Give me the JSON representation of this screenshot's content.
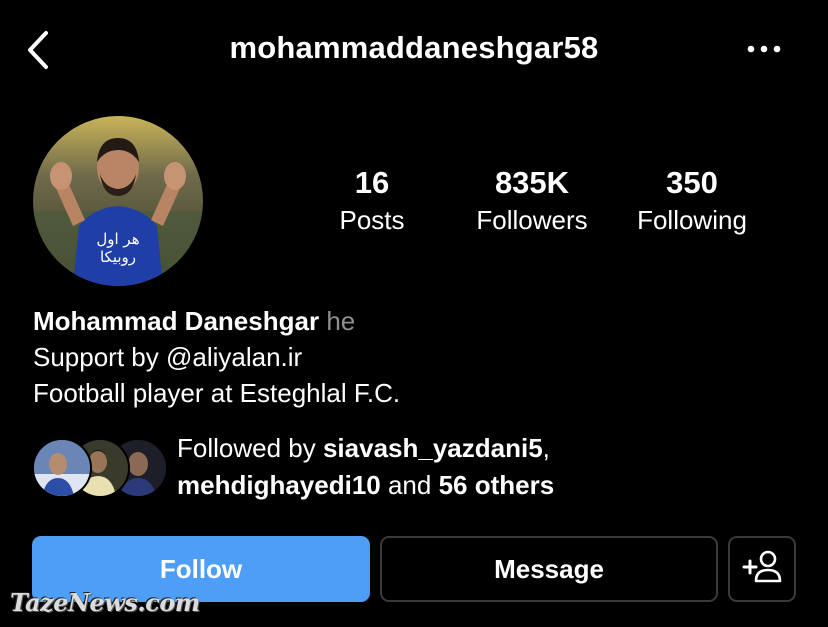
{
  "header": {
    "username": "mohammaddaneshgar58",
    "back_icon": "chevron-left-icon",
    "more_icon": "more-horizontal-icon"
  },
  "stats": [
    {
      "value": "16",
      "label": "Posts"
    },
    {
      "value": "835K",
      "label": "Followers"
    },
    {
      "value": "350",
      "label": "Following"
    }
  ],
  "bio": {
    "name": "Mohammad Daneshgar",
    "pronoun": "he",
    "line1": "Support by @aliyalan.ir",
    "line2": "Football player at Esteghlal F.C."
  },
  "followed_by": {
    "prefix": "Followed by ",
    "user1": "siavash_yazdani5",
    "comma": ",",
    "user2": "mehdighayedi10",
    "and_text": " and ",
    "others": "56 others"
  },
  "actions": {
    "follow_label": "Follow",
    "message_label": "Message",
    "add_user_icon": "add-person-icon"
  },
  "colors": {
    "accent": "#4c9ef7",
    "background": "#000000",
    "secondary_text": "#8e8e8e"
  },
  "watermark": "TazeNews.com"
}
